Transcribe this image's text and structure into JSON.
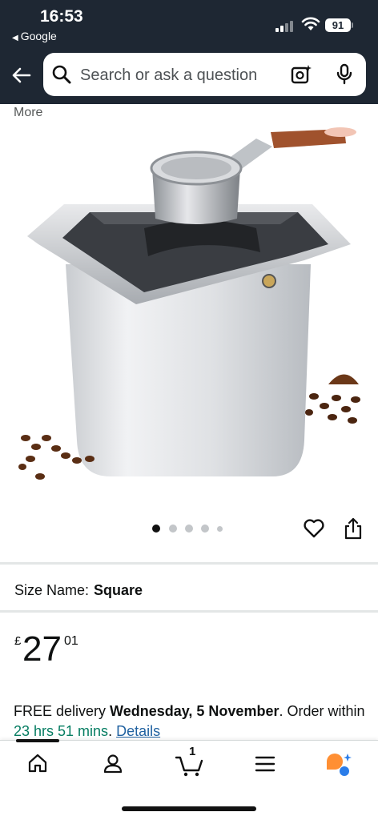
{
  "status_bar": {
    "time": "16:53",
    "back_app": "Google",
    "battery": "91"
  },
  "search": {
    "placeholder": "Search or ask a question"
  },
  "more_label": "More",
  "product": {
    "image_count": 5,
    "active_image": 1
  },
  "size": {
    "label": "Size Name:",
    "value": "Square"
  },
  "price": {
    "currency": "£",
    "whole": "27",
    "fraction": "01"
  },
  "delivery": {
    "prefix": "FREE delivery ",
    "date": "Wednesday, 5 November",
    "middle": ". Order within ",
    "countdown": "23 hrs 51 mins",
    "suffix": ". ",
    "details_link": "Details"
  },
  "bottom_nav": {
    "items": [
      "home-icon",
      "account-icon",
      "cart-icon",
      "menu-icon",
      "rufus-icon"
    ],
    "cart_count": "1"
  },
  "colors": {
    "header_bg": "#1e2733",
    "countdown": "#067d62",
    "link": "#2162a1",
    "rufus": "#ff8f33"
  }
}
